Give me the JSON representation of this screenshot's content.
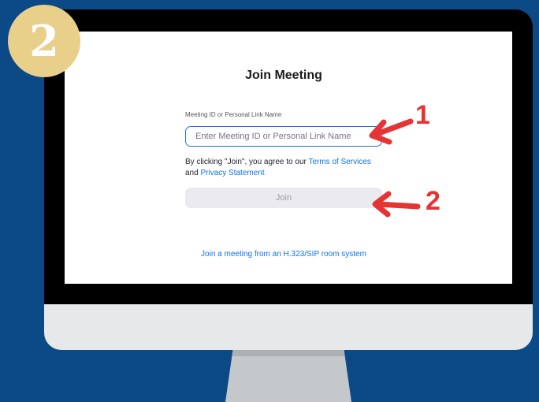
{
  "step_badge": "2",
  "dialog": {
    "title": "Join Meeting",
    "meeting_id_label": "Meeting ID or Personal Link Name",
    "meeting_id_placeholder": "Enter Meeting ID or Personal Link Name",
    "agree_prefix": "By clicking \"Join\", you agree to our ",
    "terms_link": "Terms of Services",
    "agree_and": "and ",
    "privacy_link": "Privacy Statement",
    "join_button": "Join",
    "room_system_link": "Join a meeting from an H.323/SIP room system"
  },
  "annotations": {
    "arrow_1_label": "1",
    "arrow_2_label": "2"
  },
  "colors": {
    "background": "#0b4a87",
    "badge": "#e8cf8a",
    "annotation": "#e53434",
    "link": "#0e72ed",
    "input_border": "#2d6cdf"
  },
  "icons": {
    "arrow": "red-arrow-left"
  }
}
